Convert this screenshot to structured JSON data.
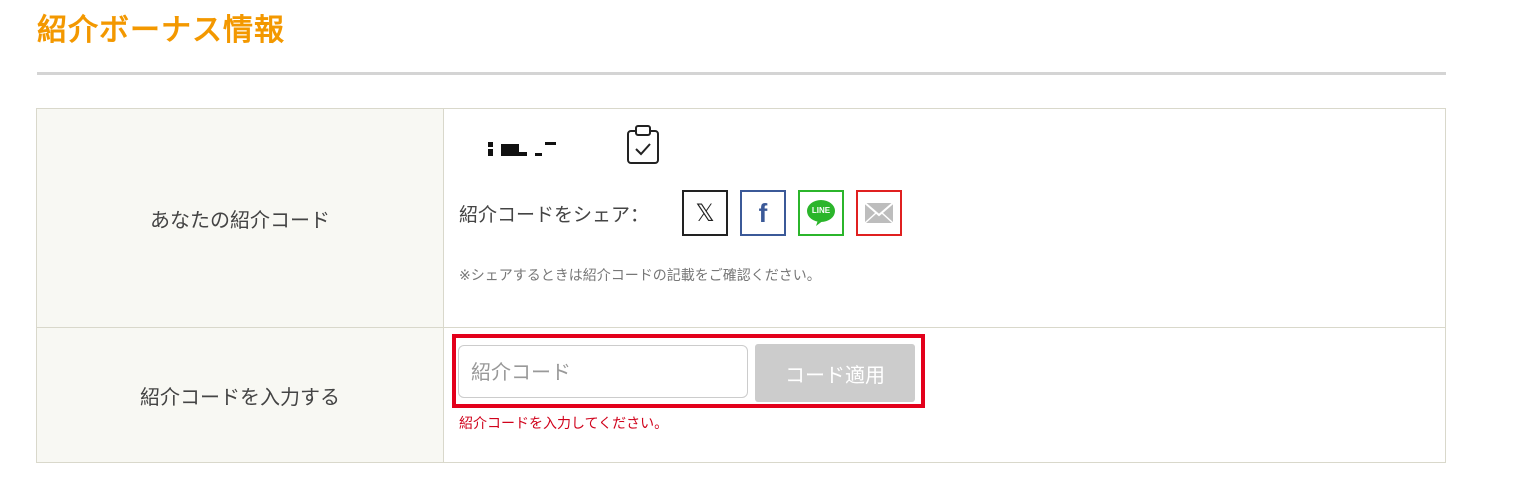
{
  "page": {
    "title": "紹介ボーナス情報"
  },
  "referral_row": {
    "label": "あなたの紹介コード",
    "copy_icon": "clipboard-check-icon",
    "share_label": "紹介コードをシェア：",
    "share_buttons": [
      {
        "name": "x",
        "icon": "x-logo-icon",
        "glyph": "𝕏",
        "color": "#222222"
      },
      {
        "name": "facebook",
        "icon": "facebook-icon",
        "glyph": "f",
        "color": "#3b5998"
      },
      {
        "name": "line",
        "icon": "line-icon",
        "glyph": "LINE",
        "color": "#2bb52b"
      },
      {
        "name": "mail",
        "icon": "mail-icon",
        "color": "#e02020"
      }
    ],
    "note": "※シェアするときは紹介コードの記載をご確認ください。"
  },
  "enter_row": {
    "label": "紹介コードを入力する",
    "input_placeholder": "紹介コード",
    "input_value": "",
    "apply_label": "コード適用",
    "error": "紹介コードを入力してください。"
  },
  "colors": {
    "title": "#f39800",
    "highlight": "#e3001b",
    "error": "#d0021b",
    "disabled_button": "#cccccc"
  }
}
